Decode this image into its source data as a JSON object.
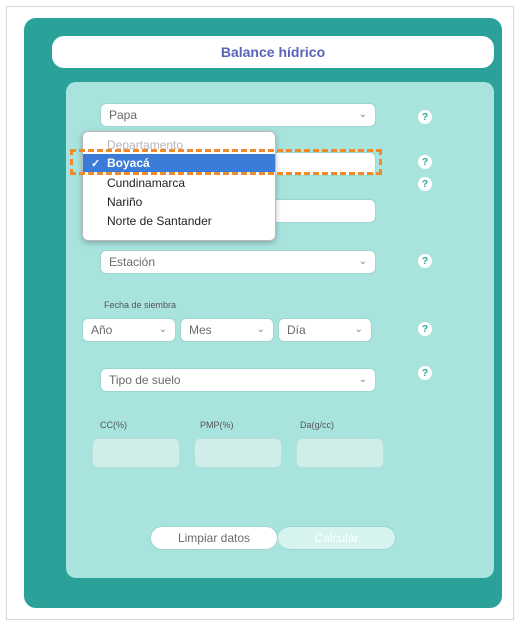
{
  "title": "Balance hídrico",
  "crop_select": {
    "value": "Papa"
  },
  "department_dropdown": {
    "options": [
      {
        "label": "Departamento",
        "state": "disabled"
      },
      {
        "label": "Boyacá",
        "state": "selected"
      },
      {
        "label": "Cundinamarca",
        "state": "normal"
      },
      {
        "label": "Nariño",
        "state": "normal"
      },
      {
        "label": "Norte de Santander",
        "state": "normal"
      }
    ]
  },
  "station_select": {
    "value": "Estación"
  },
  "sowing_date": {
    "label": "Fecha de siembra",
    "year": "Año",
    "month": "Mes",
    "day": "Día"
  },
  "soil_select": {
    "value": "Tipo de suelo"
  },
  "soil_params": {
    "cc_label": "CC(%)",
    "pmp_label": "PMP(%)",
    "da_label": "Da(g/cc)"
  },
  "buttons": {
    "clear": "Limpiar datos",
    "calculate": "Calcular"
  },
  "help_glyph": "?",
  "chevron_glyph": "⌄",
  "check_glyph": "✓",
  "colors": {
    "accent": "#2aa29a",
    "panel": "#a9e3de",
    "title": "#5864b8",
    "highlight": "#f08a2b",
    "selected": "#3b7cd9"
  }
}
